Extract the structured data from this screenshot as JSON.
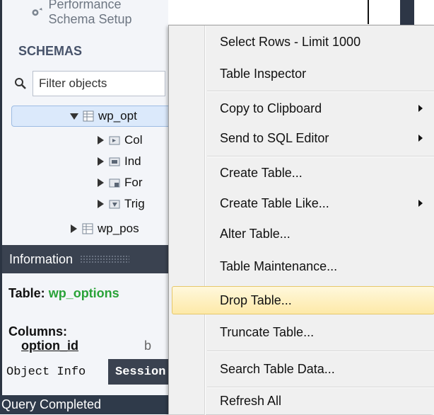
{
  "sidebar": {
    "perf_setup_label": "Performance Schema Setup",
    "schemas_title": "SCHEMAS",
    "filter_placeholder": "Filter objects",
    "tree": [
      {
        "label": "wp_opt",
        "selected": true
      },
      {
        "label": "Col"
      },
      {
        "label": "Ind"
      },
      {
        "label": "For"
      },
      {
        "label": "Trig"
      },
      {
        "label": "wp_pos"
      }
    ]
  },
  "info_panel": {
    "header": "Information",
    "table_label": "Table:",
    "table_value": "wp_options",
    "columns_label": "Columns:",
    "column_name": "option_id",
    "column_type_partial": "b",
    "tabs": [
      "Object Info",
      "Session"
    ]
  },
  "status_bar": {
    "text": "Query Completed"
  },
  "context_menu": {
    "items": [
      {
        "label": "Select Rows - Limit 1000"
      },
      {
        "label": "Table Inspector"
      },
      {
        "label": "Copy to Clipboard",
        "submenu": true
      },
      {
        "label": "Send to SQL Editor",
        "submenu": true
      },
      {
        "label": "Create Table..."
      },
      {
        "label": "Create Table Like...",
        "submenu": true
      },
      {
        "label": "Alter Table..."
      },
      {
        "label": "Table Maintenance..."
      },
      {
        "label": "Drop Table...",
        "highlighted": true
      },
      {
        "label": "Truncate Table..."
      },
      {
        "label": "Search Table Data..."
      },
      {
        "label": "Refresh All"
      }
    ]
  },
  "colors": {
    "accent_green": "#29a338",
    "dark_header": "#3a4250",
    "highlight": "#fde9a8"
  }
}
